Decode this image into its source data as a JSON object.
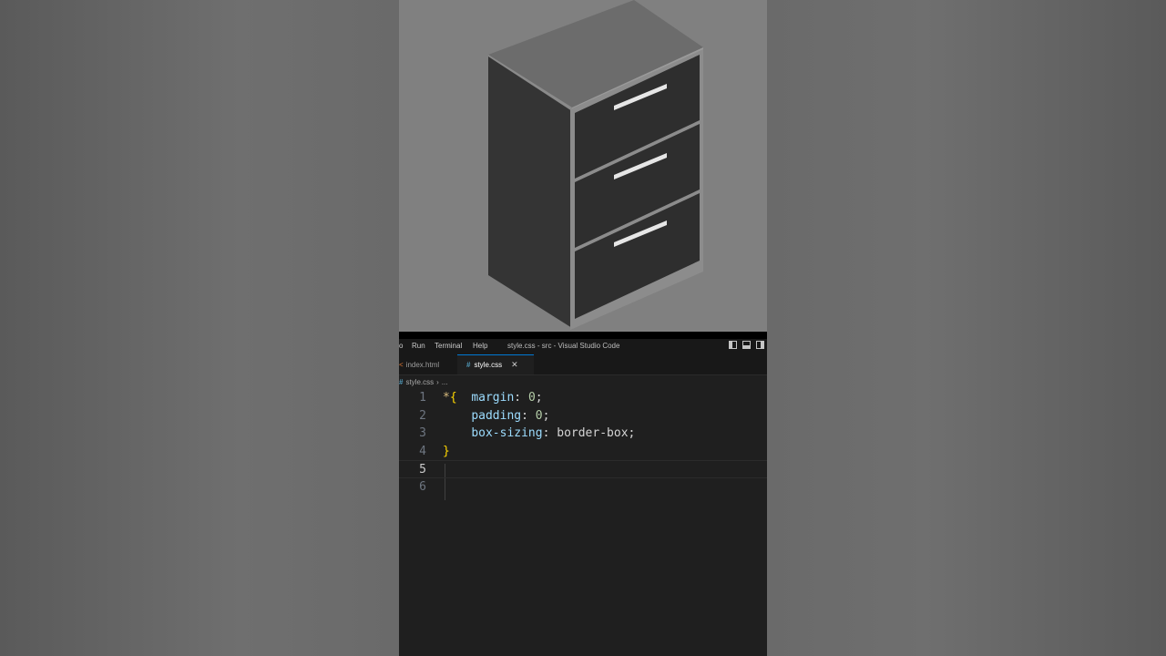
{
  "menu": {
    "partial": "o",
    "run": "Run",
    "terminal": "Terminal",
    "help": "Help",
    "window_title": "style.css - src - Visual Studio Code"
  },
  "tabs": [
    {
      "label": "index.html",
      "icon": "html-file-icon",
      "active": false
    },
    {
      "label": "style.css",
      "icon": "css-file-icon",
      "active": true
    }
  ],
  "tab_close_glyph": "✕",
  "breadcrumb": {
    "file": "style.css",
    "rest": "..."
  },
  "code": {
    "line_numbers": [
      "1",
      "2",
      "3",
      "4",
      "5",
      "6"
    ],
    "current_line": 5,
    "lines": [
      {
        "selector": "*",
        "open": "{",
        "prop": "margin",
        "colon": ":",
        "value": "0",
        "semi": ";"
      },
      {
        "prop": "padding",
        "colon": ":",
        "value": "0",
        "semi": ";"
      },
      {
        "prop": "box-sizing",
        "colon": ":",
        "value": "border-box",
        "semi": ";"
      },
      {
        "close": "}"
      }
    ]
  },
  "colors": {
    "accent": "#0078d4",
    "editor_bg": "#1f1f1f",
    "preview_bg": "#808080",
    "drawer_front": "#2e2e2e",
    "cabinet_top": "#6c6c6c",
    "cabinet_side": "#343434",
    "handle": "#e6e6e6"
  },
  "icons": [
    "html-file-icon",
    "css-file-icon",
    "close-icon",
    "chevron-right-icon",
    "layout-sidebar-left-icon",
    "layout-panel-icon",
    "layout-sidebar-right-icon"
  ]
}
